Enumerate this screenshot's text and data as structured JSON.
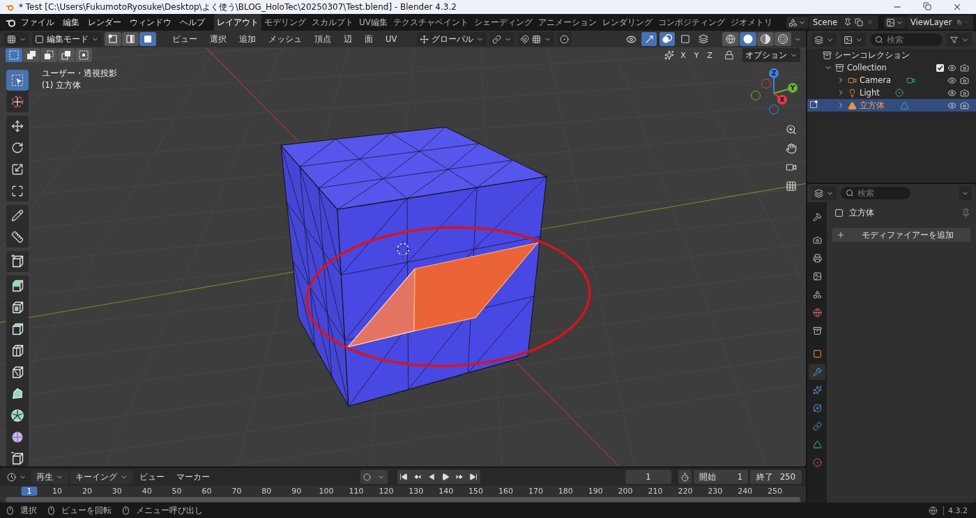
{
  "window": {
    "title": "* Test [C:\\Users\\FukumotoRyosuke\\Desktop\\よく使う\\BLOG_HoloTec\\20250307\\Test.blend] - Blender 4.3.2"
  },
  "menu": [
    "ファイル",
    "編集",
    "レンダー",
    "ウィンドウ",
    "ヘルプ"
  ],
  "workspaces": [
    {
      "label": "レイアウト",
      "selected": true
    },
    {
      "label": "モデリング",
      "selected": false
    },
    {
      "label": "スカルプト",
      "selected": false
    },
    {
      "label": "UV編集",
      "selected": false
    },
    {
      "label": "テクスチャペイント",
      "selected": false
    },
    {
      "label": "シェーディング",
      "selected": false
    },
    {
      "label": "アニメーション",
      "selected": false
    },
    {
      "label": "レンダリング",
      "selected": false
    },
    {
      "label": "コンポジティング",
      "selected": false
    },
    {
      "label": "ジオメトリ",
      "selected": false
    }
  ],
  "scene": {
    "value": "Scene"
  },
  "view_layer": {
    "value": "ViewLayer"
  },
  "viewport": {
    "mode": "編集モード",
    "select_modes": [
      {
        "kind": "vertex",
        "selected": false
      },
      {
        "kind": "edge",
        "selected": false
      },
      {
        "kind": "face",
        "selected": true
      }
    ],
    "menus": [
      "ビュー",
      "選択",
      "追加",
      "メッシュ",
      "頂点",
      "辺",
      "面",
      "UV"
    ],
    "orientation": "グローバル",
    "toggles": [
      {
        "kind": "visibility",
        "on": false
      },
      {
        "kind": "gizmo",
        "on": true
      },
      {
        "kind": "overlay",
        "on": true
      },
      {
        "kind": "mesh-overlay",
        "on": false
      },
      {
        "kind": "xray",
        "on": false
      }
    ],
    "shading": [
      {
        "kind": "wireframe",
        "selected": false
      },
      {
        "kind": "solid",
        "selected": true
      },
      {
        "kind": "material",
        "selected": false
      },
      {
        "kind": "rendered",
        "selected": false
      }
    ],
    "box_modes": [
      {
        "kind": "new",
        "selected": true
      },
      {
        "kind": "extend",
        "selected": false
      },
      {
        "kind": "subtract",
        "selected": false
      },
      {
        "kind": "invert",
        "selected": false
      },
      {
        "kind": "intersect",
        "selected": false
      }
    ],
    "mirror": [
      {
        "label": "X",
        "on": false
      },
      {
        "label": "Y",
        "on": false
      },
      {
        "label": "Z",
        "on": false
      }
    ],
    "options": "オプション",
    "overlay_text": [
      "ユーザー・透視投影",
      "(1) 立方体"
    ],
    "gizmo_axes": [
      "Z",
      "Y",
      "X"
    ]
  },
  "tool_groups": [
    [
      {
        "kind": "select",
        "selected": true
      },
      {
        "kind": "cursor",
        "selected": false
      }
    ],
    [
      {
        "kind": "move",
        "selected": false
      },
      {
        "kind": "rotate",
        "selected": false
      },
      {
        "kind": "scale",
        "selected": false
      },
      {
        "kind": "transform",
        "selected": false
      }
    ],
    [
      {
        "kind": "annotate",
        "selected": false
      },
      {
        "kind": "measure",
        "selected": false
      }
    ],
    [
      {
        "kind": "add-cube",
        "selected": false
      }
    ],
    [
      {
        "kind": "extrude",
        "selected": false
      },
      {
        "kind": "inset",
        "selected": false
      },
      {
        "kind": "bevel",
        "selected": false
      },
      {
        "kind": "loopcut",
        "selected": false
      },
      {
        "kind": "knife",
        "selected": false
      },
      {
        "kind": "polybuild",
        "selected": false
      },
      {
        "kind": "spin",
        "selected": false
      },
      {
        "kind": "smooth",
        "selected": false
      },
      {
        "kind": "slide",
        "selected": false
      }
    ]
  ],
  "outliner": {
    "search": {
      "placeholder": "検索"
    },
    "root": "シーンコレクション",
    "collections": [
      {
        "label": "Collection",
        "expanded": true,
        "checked": true,
        "children": [
          {
            "label": "Camera",
            "kind": "camera",
            "expanded": false,
            "selected": false
          },
          {
            "label": "Light",
            "kind": "light",
            "expanded": false,
            "selected": false
          },
          {
            "label": "立方体",
            "kind": "mesh",
            "expanded": false,
            "selected": true
          }
        ]
      }
    ]
  },
  "properties": {
    "search": {
      "placeholder": "検索"
    },
    "object": "立方体",
    "add_button": "モディファイアーを追加",
    "tab_groups": [
      [
        {
          "kind": "tool",
          "selected": false
        }
      ],
      [
        {
          "kind": "render",
          "selected": false
        },
        {
          "kind": "output",
          "selected": false
        },
        {
          "kind": "view-layer",
          "selected": false
        },
        {
          "kind": "scene",
          "selected": false
        },
        {
          "kind": "world",
          "selected": false
        },
        {
          "kind": "collection",
          "selected": false
        }
      ],
      [
        {
          "kind": "object",
          "selected": false
        },
        {
          "kind": "modifier",
          "selected": true
        },
        {
          "kind": "particles",
          "selected": false
        },
        {
          "kind": "physics",
          "selected": false
        },
        {
          "kind": "constraints",
          "selected": false
        },
        {
          "kind": "data",
          "selected": false
        },
        {
          "kind": "material",
          "selected": false
        }
      ]
    ]
  },
  "timeline": {
    "menus": [
      {
        "label": "再生",
        "dropdown": true
      },
      {
        "label": "キーイング",
        "dropdown": true
      },
      {
        "label": "ビュー",
        "dropdown": false
      },
      {
        "label": "マーカー",
        "dropdown": false
      }
    ],
    "current_frame": "1",
    "start_label": "開始",
    "start": "1",
    "end_label": "終了",
    "end": "250",
    "ruler": [
      {
        "label": "1",
        "selected": true
      },
      {
        "label": "10",
        "selected": false
      },
      {
        "label": "20",
        "selected": false
      },
      {
        "label": "30",
        "selected": false
      },
      {
        "label": "40",
        "selected": false
      },
      {
        "label": "50",
        "selected": false
      },
      {
        "label": "60",
        "selected": false
      },
      {
        "label": "70",
        "selected": false
      },
      {
        "label": "80",
        "selected": false
      },
      {
        "label": "90",
        "selected": false
      },
      {
        "label": "100",
        "selected": false
      },
      {
        "label": "110",
        "selected": false
      },
      {
        "label": "120",
        "selected": false
      },
      {
        "label": "130",
        "selected": false
      },
      {
        "label": "140",
        "selected": false
      },
      {
        "label": "150",
        "selected": false
      },
      {
        "label": "160",
        "selected": false
      },
      {
        "label": "170",
        "selected": false
      },
      {
        "label": "180",
        "selected": false
      },
      {
        "label": "190",
        "selected": false
      },
      {
        "label": "200",
        "selected": false
      },
      {
        "label": "210",
        "selected": false
      },
      {
        "label": "220",
        "selected": false
      },
      {
        "label": "230",
        "selected": false
      },
      {
        "label": "240",
        "selected": false
      },
      {
        "label": "250",
        "selected": false
      }
    ]
  },
  "status_bar": {
    "hints": [
      "選択",
      "ビューを回転",
      "メニュー呼び出し"
    ],
    "version": "4.3.2"
  }
}
